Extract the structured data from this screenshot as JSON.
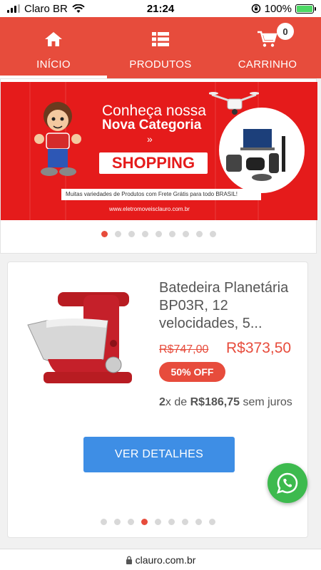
{
  "status_bar": {
    "carrier": "Claro BR",
    "time": "21:24",
    "battery_percent": "100%",
    "battery_level": 1.0
  },
  "nav": {
    "items": [
      {
        "label": "INÍCIO",
        "icon": "home-icon",
        "active": true
      },
      {
        "label": "PRODUTOS",
        "icon": "list-icon",
        "active": false
      },
      {
        "label": "CARRINHO",
        "icon": "cart-icon",
        "active": false
      }
    ],
    "cart_count": "0"
  },
  "banner": {
    "headline_line1": "Conheça nossa",
    "headline_line2": "Nova Categoria",
    "chevron": "»",
    "category": "SHOPPING",
    "strip_text": "Muitas variedades de Produtos com Frete Grátis para todo BRASIL!",
    "url": "www.eletromoveisclauro.com.br",
    "dots_total": 9,
    "dots_active_index": 0
  },
  "product": {
    "name": "Batedeira Planetária BP03R, 12 velocidades, 5...",
    "old_price": "R$747,00",
    "new_price": "R$373,50",
    "discount": "50% OFF",
    "installments_count": "2",
    "installments_prefix": "x de",
    "installments_value": "R$186,75",
    "installments_suffix": "sem juros",
    "button_label": "VER DETALHES",
    "dots_total": 9,
    "dots_active_index": 3
  },
  "url_bar": {
    "domain": "clauro.com.br"
  },
  "colors": {
    "brand_red": "#e74c3c",
    "button_blue": "#3e8ee5",
    "whatsapp_green": "#3dba4e"
  }
}
